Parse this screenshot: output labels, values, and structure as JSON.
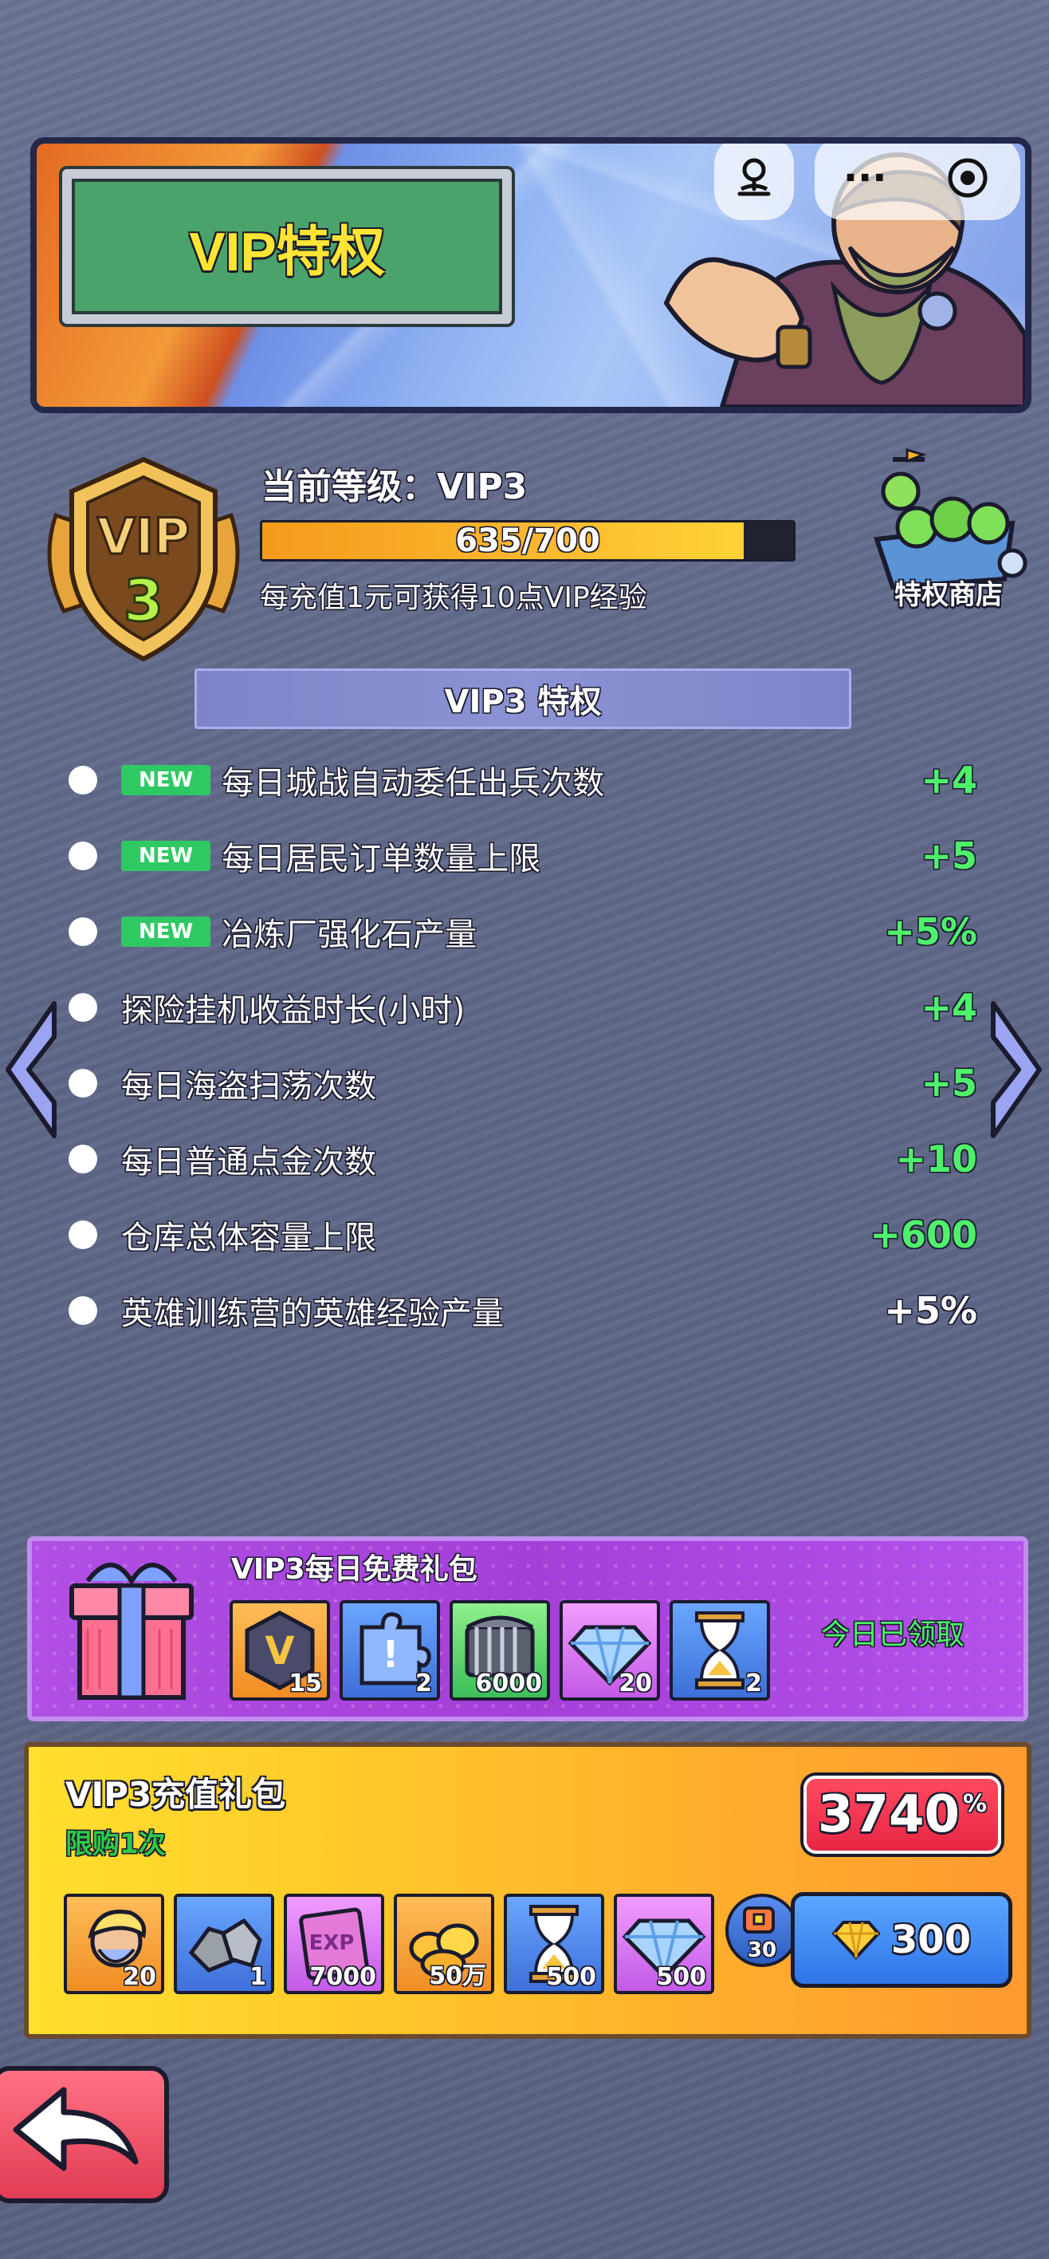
{
  "banner": {
    "title": "VIP特权"
  },
  "top_buttons": {
    "more": "···"
  },
  "vip": {
    "badge_text": "VIP",
    "badge_level": "3",
    "level_label": "当前等级：VIP3",
    "progress_text": "635/700",
    "progress_fraction": 0.907,
    "hint": "每充值1元可获得10点VIP经验"
  },
  "shop": {
    "label": "特权商店"
  },
  "privileges": {
    "header": "VIP3 特权",
    "new_tag": "NEW",
    "items": [
      {
        "label": "每日城战自动委任出兵次数",
        "value": "+4",
        "is_new": true
      },
      {
        "label": "每日居民订单数量上限",
        "value": "+5",
        "is_new": true
      },
      {
        "label": "冶炼厂强化石产量",
        "value": "+5%",
        "is_new": true
      },
      {
        "label": "探险挂机收益时长(小时)",
        "value": "+4",
        "is_new": false
      },
      {
        "label": "每日海盗扫荡次数",
        "value": "+5",
        "is_new": false
      },
      {
        "label": "每日普通点金次数",
        "value": "+10",
        "is_new": false
      },
      {
        "label": "仓库总体容量上限",
        "value": "+600",
        "is_new": false
      },
      {
        "label": "英雄训练营的英雄经验产量",
        "value": "+5%",
        "is_new": false
      }
    ],
    "value_color": "#4ff06b",
    "last_value_color": "#ffffff"
  },
  "daily_gift": {
    "title": "VIP3每日免费礼包",
    "status": "今日已领取",
    "items": [
      {
        "icon": "vip-exp-badge-icon",
        "count": "15",
        "badge": "V"
      },
      {
        "icon": "puzzle-piece-icon",
        "count": "2",
        "badge": "!"
      },
      {
        "icon": "iron-cage-icon",
        "count": "6000"
      },
      {
        "icon": "diamond-icon",
        "count": "20"
      },
      {
        "icon": "hourglass-icon",
        "count": "2"
      }
    ]
  },
  "recharge_gift": {
    "title": "VIP3充值礼包",
    "limit": "限购1次",
    "discount_value": "3740",
    "discount_unit": "%",
    "items": [
      {
        "icon": "hero-portrait-icon",
        "count": "20"
      },
      {
        "icon": "ore-stones-icon",
        "count": "1"
      },
      {
        "icon": "exp-book-icon",
        "count": "7000",
        "badge": "EXP"
      },
      {
        "icon": "gold-pile-icon",
        "count": "50万"
      },
      {
        "icon": "hourglass-icon",
        "count": "500"
      },
      {
        "icon": "diamond-icon",
        "count": "500"
      }
    ],
    "bonus_count": "30",
    "price": "300"
  }
}
